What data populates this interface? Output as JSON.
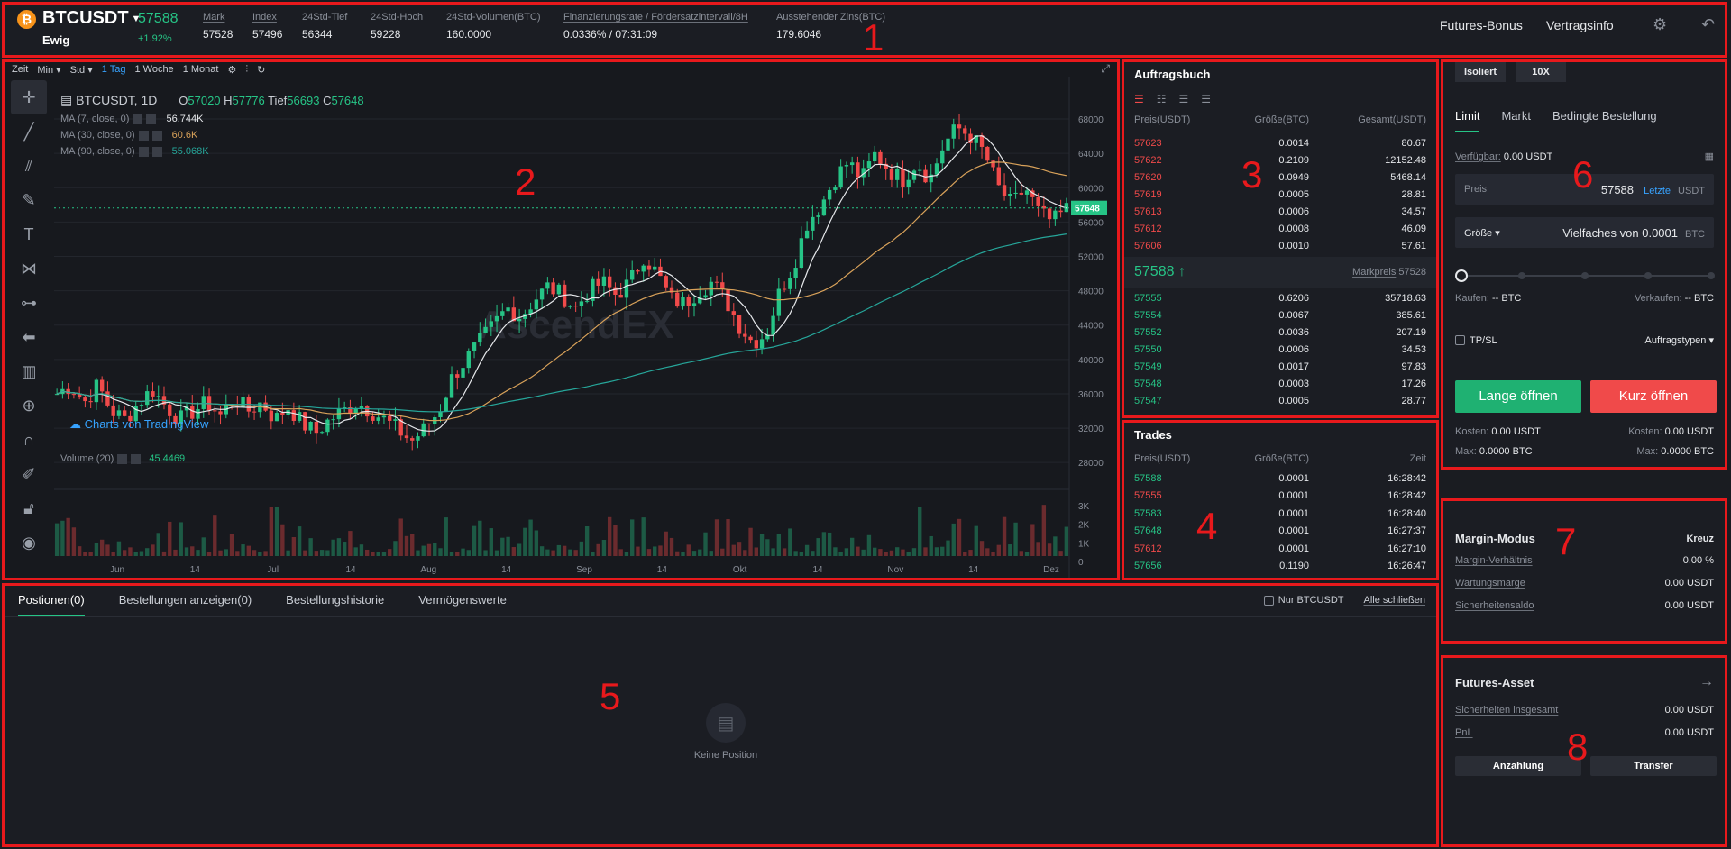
{
  "header": {
    "symbol": "BTCUSDT",
    "subtitle": "Ewig",
    "last_price": "57588",
    "change": "+1.92%",
    "stats": [
      {
        "label": "Mark",
        "value": "57528"
      },
      {
        "label": "Index",
        "value": "57496"
      },
      {
        "label": "24Std-Tief",
        "value": "56344"
      },
      {
        "label": "24Std-Hoch",
        "value": "59228"
      },
      {
        "label": "24Std-Volumen(BTC)",
        "value": "160.0000"
      },
      {
        "label": "Finanzierungsrate / Fördersatzintervall/8H",
        "value": "0.0336% / 07:31:09"
      },
      {
        "label": "Ausstehender Zins(BTC)",
        "value": "179.6046"
      }
    ],
    "links": [
      "Futures-Bonus",
      "Vertragsinfo"
    ]
  },
  "chart": {
    "toolbar": [
      "Zeit",
      "Min ▾",
      "Std ▾",
      "1 Tag",
      "1 Woche",
      "1 Monat"
    ],
    "title": "BTCUSDT, 1D",
    "ohlc": {
      "o_label": "O",
      "o": "57020",
      "h_label": "H",
      "h": "57776",
      "l_label": "Tief",
      "l": "56693",
      "c_label": "C",
      "c": "57648"
    },
    "ma": [
      {
        "label": "MA (7, close, 0)",
        "value": "56.744K",
        "color": "#e6e8eb"
      },
      {
        "label": "MA (30, close, 0)",
        "value": "60.6K",
        "color": "#d9a25a"
      },
      {
        "label": "MA (90, close, 0)",
        "value": "55.068K",
        "color": "#26a69a"
      }
    ],
    "tv_brand": "Charts von TradingView",
    "watermark": "AscendEX",
    "volume_label": "Volume (20)",
    "volume_value": "45.4469",
    "price_tag": "57648",
    "marker_3": "3"
  },
  "chart_data": {
    "type": "candlestick",
    "title": "BTCUSDT, 1D",
    "y_ticks": [
      28000,
      32000,
      36000,
      40000,
      44000,
      48000,
      52000,
      56000,
      60000,
      64000,
      68000
    ],
    "volume_ticks": [
      "3K",
      "2K",
      "1K",
      "0"
    ],
    "x_ticks": [
      "Jun",
      "14",
      "Jul",
      "14",
      "Aug",
      "14",
      "Sep",
      "14",
      "Okt",
      "14",
      "Nov",
      "14",
      "Dez"
    ],
    "ylim": [
      25500,
      70000
    ],
    "close_path": [
      36000,
      37000,
      35000,
      37000,
      34000,
      33000,
      35000,
      36500,
      34500,
      33000,
      34000,
      35000,
      33500,
      35500,
      34000,
      35000,
      33000,
      34500,
      32500,
      31500,
      33000,
      34000,
      35000,
      34000,
      33000,
      31800,
      30500,
      32000,
      34000,
      38000,
      40000,
      42000,
      44000,
      46000,
      45000,
      47000,
      48500,
      47500,
      46000,
      48000,
      49000,
      47500,
      49000,
      52000,
      50000,
      47000,
      46500,
      48000,
      49000,
      47000,
      44000,
      42000,
      43000,
      48000,
      51000,
      56000,
      58000,
      61000,
      63000,
      61000,
      64000,
      62000,
      61000,
      63000,
      61000,
      65000,
      67000,
      66000,
      64000,
      60000,
      58000,
      60000,
      57000,
      56000,
      57500
    ]
  },
  "orderbook": {
    "title": "Auftragsbuch",
    "headers": [
      "Preis(USDT)",
      "Größe(BTC)",
      "Gesamt(USDT)"
    ],
    "asks": [
      [
        "57623",
        "0.0014",
        "80.67"
      ],
      [
        "57622",
        "0.2109",
        "12152.48"
      ],
      [
        "57620",
        "0.0949",
        "5468.14"
      ],
      [
        "57619",
        "0.0005",
        "28.81"
      ],
      [
        "57613",
        "0.0006",
        "34.57"
      ],
      [
        "57612",
        "0.0008",
        "46.09"
      ],
      [
        "57606",
        "0.0010",
        "57.61"
      ]
    ],
    "mid_price": "57588 ↑",
    "mark_label": "Markpreis",
    "mark_price": "57528",
    "bids": [
      [
        "57555",
        "0.6206",
        "35718.63"
      ],
      [
        "57554",
        "0.0067",
        "385.61"
      ],
      [
        "57552",
        "0.0036",
        "207.19"
      ],
      [
        "57550",
        "0.0006",
        "34.53"
      ],
      [
        "57549",
        "0.0017",
        "97.83"
      ],
      [
        "57548",
        "0.0003",
        "17.26"
      ],
      [
        "57547",
        "0.0005",
        "28.77"
      ]
    ]
  },
  "trades": {
    "title": "Trades",
    "headers": [
      "Preis(USDT)",
      "Größe(BTC)",
      "Zeit"
    ],
    "rows": [
      {
        "p": "57588",
        "s": "0.0001",
        "t": "16:28:42",
        "side": "buy"
      },
      {
        "p": "57555",
        "s": "0.0001",
        "t": "16:28:42",
        "side": "sell"
      },
      {
        "p": "57583",
        "s": "0.0001",
        "t": "16:28:40",
        "side": "buy"
      },
      {
        "p": "57648",
        "s": "0.0001",
        "t": "16:27:37",
        "side": "buy"
      },
      {
        "p": "57612",
        "s": "0.0001",
        "t": "16:27:10",
        "side": "sell"
      },
      {
        "p": "57656",
        "s": "0.1190",
        "t": "16:26:47",
        "side": "buy"
      }
    ]
  },
  "positions": {
    "tabs": [
      "Postionen(0)",
      "Bestellungen anzeigen(0)",
      "Bestellungshistorie",
      "Vermögenswerte"
    ],
    "only_label": "Nur BTCUSDT",
    "close_all": "Alle schließen",
    "empty": "Keine Position"
  },
  "order_form": {
    "mode": "Isoliert",
    "leverage": "10X",
    "tabs": [
      "Limit",
      "Markt",
      "Bedingte Bestellung"
    ],
    "available_label": "Verfügbar:",
    "available_value": "0.00 USDT",
    "price_label": "Preis",
    "price_value": "57588",
    "price_last": "Letzte",
    "price_unit": "USDT",
    "size_label": "Größe ▾",
    "size_placeholder": "Vielfaches von 0.0001",
    "size_unit": "BTC",
    "buy_label": "Kaufen:",
    "buy_value": "-- BTC",
    "sell_label": "Verkaufen:",
    "sell_value": "-- BTC",
    "tpsl": "TP/SL",
    "order_types": "Auftragstypen ▾",
    "long_btn": "Lange öffnen",
    "short_btn": "Kurz öffnen",
    "cost_label": "Kosten:",
    "cost_left": "0.00 USDT",
    "cost_right": "0.00 USDT",
    "max_label": "Max:",
    "max_left": "0.0000 BTC",
    "max_right": "0.0000 BTC"
  },
  "margin": {
    "title": "Margin-Modus",
    "mode": "Kreuz",
    "rows": [
      {
        "label": "Margin-Verhältnis",
        "value": "0.00 %"
      },
      {
        "label": "Wartungsmarge",
        "value": "0.00 USDT"
      },
      {
        "label": "Sicherheitensaldo",
        "value": "0.00 USDT"
      }
    ]
  },
  "asset": {
    "title": "Futures-Asset",
    "rows": [
      {
        "label": "Sicherheiten insgesamt",
        "value": "0.00 USDT"
      },
      {
        "label": "PnL",
        "value": "0.00 USDT"
      }
    ],
    "deposit": "Anzahlung",
    "transfer": "Transfer"
  },
  "regions": [
    "1",
    "2",
    "3",
    "4",
    "5",
    "6",
    "7",
    "8"
  ],
  "colors": {
    "buy": "#26c486",
    "sell": "#f04a4a",
    "accent": "#37a3ff",
    "annotation": "#e8191c"
  }
}
